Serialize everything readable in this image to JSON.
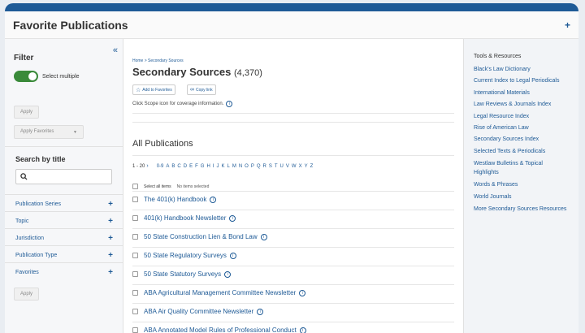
{
  "header": {
    "title": "Favorite Publications",
    "plus": "+"
  },
  "filter": {
    "title": "Filter",
    "collapse": "«",
    "select_multiple": "Select multiple",
    "apply": "Apply",
    "apply_favorites": "Apply Favorites",
    "search_title": "Search by title",
    "facets": [
      {
        "label": "Publication Series"
      },
      {
        "label": "Topic"
      },
      {
        "label": "Jurisdiction"
      },
      {
        "label": "Publication Type"
      },
      {
        "label": "Favorites"
      }
    ],
    "apply_bottom": "Apply"
  },
  "main": {
    "breadcrumb": "Home > Secondary Sources",
    "title": "Secondary Sources",
    "count": "(4,370)",
    "add_favorites": "Add to Favorites",
    "copy_link": "Copy link",
    "note": "Click Scope icon for coverage information.",
    "all_publications": "All Publications",
    "range": "1 - 20",
    "letters": [
      "0-9",
      "A",
      "B",
      "C",
      "D",
      "E",
      "F",
      "G",
      "H",
      "I",
      "J",
      "K",
      "L",
      "M",
      "N",
      "O",
      "P",
      "Q",
      "R",
      "S",
      "T",
      "U",
      "V",
      "W",
      "X",
      "Y",
      "Z"
    ],
    "select_all": "Select all items",
    "no_items": "No items selected",
    "publications": [
      "The 401(k) Handbook",
      "401(k) Handbook Newsletter",
      "50 State Construction Lien & Bond Law",
      "50 State Regulatory Surveys",
      "50 State Statutory Surveys",
      "ABA Agricultural Management Committee Newsletter",
      "ABA Air Quality Committee Newsletter",
      "ABA Annotated Model Rules of Professional Conduct"
    ]
  },
  "tools": {
    "title": "Tools & Resources",
    "links": [
      "Black's Law Dictionary",
      "Current Index to Legal Periodicals",
      "International Materials",
      "Law Reviews & Journals Index",
      "Legal Resource Index",
      "Rise of American Law",
      "Secondary Sources Index",
      "Selected Texts & Periodicals",
      "Westlaw Bulletins & Topical Highlights",
      "Words & Phrases",
      "World Journals",
      "More Secondary Sources Resources"
    ]
  }
}
